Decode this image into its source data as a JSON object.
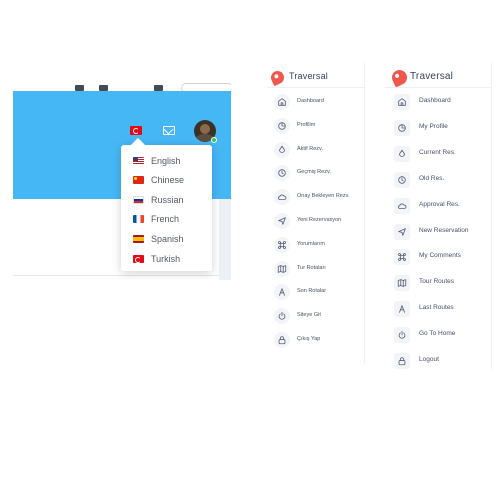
{
  "language_menu": {
    "items": [
      {
        "label": "English",
        "flag": "flag-us-icon"
      },
      {
        "label": "Chinese",
        "flag": "flag-cn-icon"
      },
      {
        "label": "Russian",
        "flag": "flag-ru-icon"
      },
      {
        "label": "French",
        "flag": "flag-fr-icon"
      },
      {
        "label": "Spanish",
        "flag": "flag-es-icon"
      },
      {
        "label": "Turkish",
        "flag": "flag-tr-icon"
      }
    ]
  },
  "header": {
    "background_color": "#46b7f5",
    "current_language_icon": "flag-tr-icon",
    "mail_icon": "mail-icon",
    "avatar_status_color": "#34c759"
  },
  "sidebar_tr": {
    "brand": "Traversal",
    "items": [
      {
        "label": "Dashboard",
        "icon": "home-icon"
      },
      {
        "label": "Profilim",
        "icon": "pie-chart-icon"
      },
      {
        "label": "Aktif Rezv.",
        "icon": "droplet-icon"
      },
      {
        "label": "Geçmiş Rezv.",
        "icon": "clock-icon"
      },
      {
        "label": "Onay Bekleyen Rezv.",
        "icon": "cloud-icon"
      },
      {
        "label": "Yeni Rezervasyon",
        "icon": "navigation-icon"
      },
      {
        "label": "Yorumlarım",
        "icon": "command-icon"
      },
      {
        "label": "Tur Rotaları",
        "icon": "map-icon"
      },
      {
        "label": "Son Rotalar",
        "icon": "anchor-icon"
      },
      {
        "label": "Siteye Git",
        "icon": "power-icon"
      },
      {
        "label": "Çıkış Yap",
        "icon": "lock-icon"
      }
    ]
  },
  "sidebar_en": {
    "brand": "Traversal",
    "items": [
      {
        "label": "Dashboard",
        "icon": "home-icon"
      },
      {
        "label": "My Profile",
        "icon": "pie-chart-icon"
      },
      {
        "label": "Current Res.",
        "icon": "droplet-icon"
      },
      {
        "label": "Old Res.",
        "icon": "clock-icon"
      },
      {
        "label": "Approval Res.",
        "icon": "cloud-icon"
      },
      {
        "label": "New Reservation",
        "icon": "navigation-icon"
      },
      {
        "label": "My Comments",
        "icon": "command-icon"
      },
      {
        "label": "Tour Routes",
        "icon": "map-icon"
      },
      {
        "label": "Last Routes",
        "icon": "anchor-icon"
      },
      {
        "label": "Go To Home",
        "icon": "power-icon"
      },
      {
        "label": "Logout",
        "icon": "lock-icon"
      }
    ]
  },
  "colors": {
    "brand_accent": "#f2574c",
    "sidebar_text": "#4a4f6a",
    "icon_stroke": "#5a5f78"
  }
}
